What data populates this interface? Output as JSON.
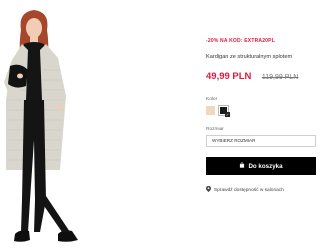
{
  "product": {
    "promo_text": "-20% NA KOD: EXTRA20PL",
    "title": "Kardigan ze strukturalnym splotem",
    "price_sale": "49,99 PLN",
    "price_old": "119,99 PLN"
  },
  "color": {
    "label": "Kolor",
    "swatches": [
      {
        "name": "beige",
        "hex": "#efd9c3",
        "selected": false
      },
      {
        "name": "black",
        "hex": "#1a1a1a",
        "selected": true
      }
    ]
  },
  "size": {
    "label": "Rozmiar",
    "select_value": "WYBIERZ ROZMIAR"
  },
  "cart": {
    "button_label": "Do koszyka"
  },
  "store": {
    "link_label": "Sprawdź dostępność w salonach"
  },
  "theme": {
    "accent": "#e2183c",
    "button_bg": "#000000"
  }
}
